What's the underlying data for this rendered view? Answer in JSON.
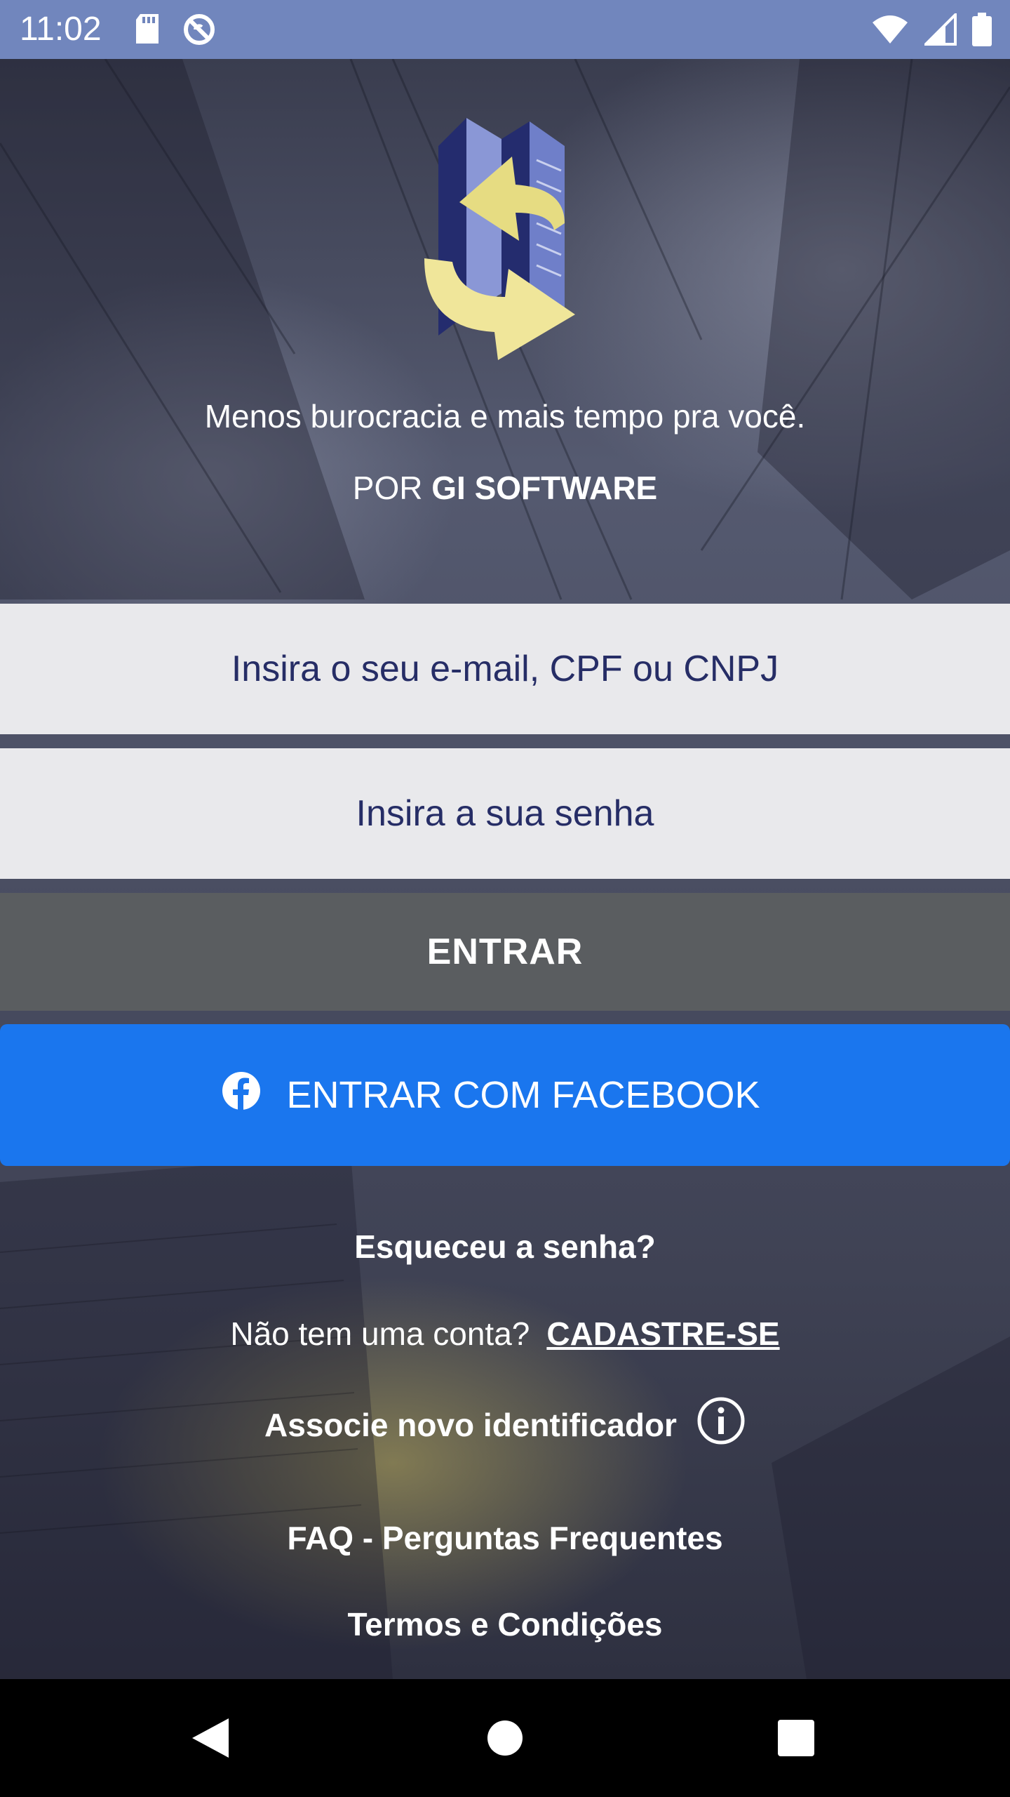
{
  "status_bar": {
    "time": "11:02",
    "icons": [
      "sd-card-icon",
      "no-sync-icon",
      "wifi-icon",
      "cell-signal-icon",
      "battery-icon"
    ]
  },
  "hero": {
    "tagline": "Menos burocracia e mais tempo pra você.",
    "by_prefix": "POR ",
    "by_brand": "GI SOFTWARE"
  },
  "form": {
    "email_placeholder": "Insira o seu e-mail, CPF ou CNPJ",
    "password_placeholder": "Insira a sua senha",
    "login_label": "ENTRAR",
    "facebook_label": "ENTRAR COM FACEBOOK"
  },
  "links": {
    "forgot_password": "Esqueceu a senha?",
    "no_account_prompt": "Não tem uma conta?",
    "signup": "CADASTRE-SE",
    "associate_identifier": "Associe novo identificador",
    "faq": "FAQ - Perguntas Frequentes",
    "terms": "Termos e Condições"
  },
  "colors": {
    "status_bar": "#7186bd",
    "input_bg": "#e9e9ec",
    "input_text": "#262d66",
    "login_button": "#5a5d60",
    "facebook_button": "#1a76ee"
  }
}
